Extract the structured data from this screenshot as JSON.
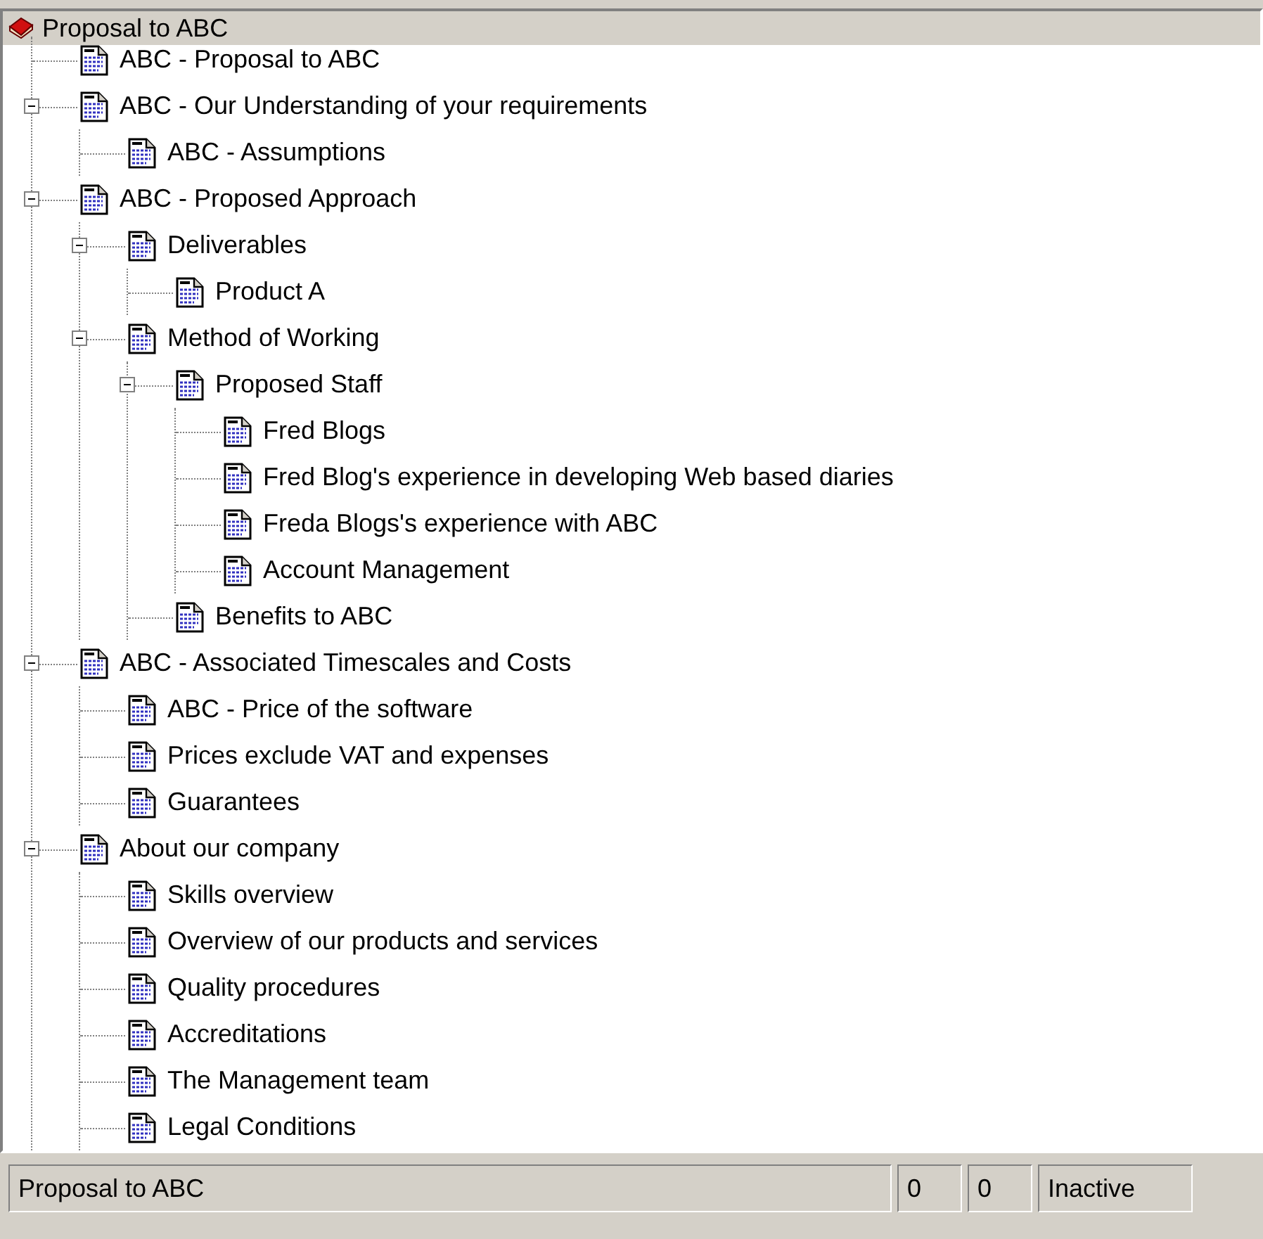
{
  "tree": {
    "label": "Proposal to ABC",
    "selected": true,
    "children": [
      {
        "label": "ABC - Proposal to ABC"
      },
      {
        "label": "ABC - Our Understanding of your requirements",
        "expanded": true,
        "children": [
          {
            "label": "ABC - Assumptions"
          }
        ]
      },
      {
        "label": "ABC - Proposed Approach",
        "expanded": true,
        "children": [
          {
            "label": "Deliverables",
            "expanded": true,
            "children": [
              {
                "label": "Product A"
              }
            ]
          },
          {
            "label": "Method of Working",
            "expanded": true,
            "children": [
              {
                "label": "Proposed Staff",
                "expanded": true,
                "children": [
                  {
                    "label": "Fred Blogs"
                  },
                  {
                    "label": "Fred Blog's experience in developing Web based diaries"
                  },
                  {
                    "label": "Freda Blogs's experience with ABC"
                  },
                  {
                    "label": "Account Management"
                  }
                ]
              },
              {
                "label": "Benefits to ABC"
              }
            ]
          }
        ]
      },
      {
        "label": "ABC - Associated Timescales and Costs",
        "expanded": true,
        "children": [
          {
            "label": "ABC - Price of the software"
          },
          {
            "label": "Prices exclude VAT and expenses"
          },
          {
            "label": "Guarantees"
          }
        ]
      },
      {
        "label": "About our company",
        "expanded": true,
        "children": [
          {
            "label": "Skills overview"
          },
          {
            "label": "Overview of our products and services"
          },
          {
            "label": "Quality procedures"
          },
          {
            "label": "Accreditations"
          },
          {
            "label": "The Management team"
          },
          {
            "label": "Legal Conditions"
          }
        ]
      }
    ]
  },
  "status_bar": [
    "Proposal to ABC",
    "0",
    "0",
    "Inactive"
  ]
}
